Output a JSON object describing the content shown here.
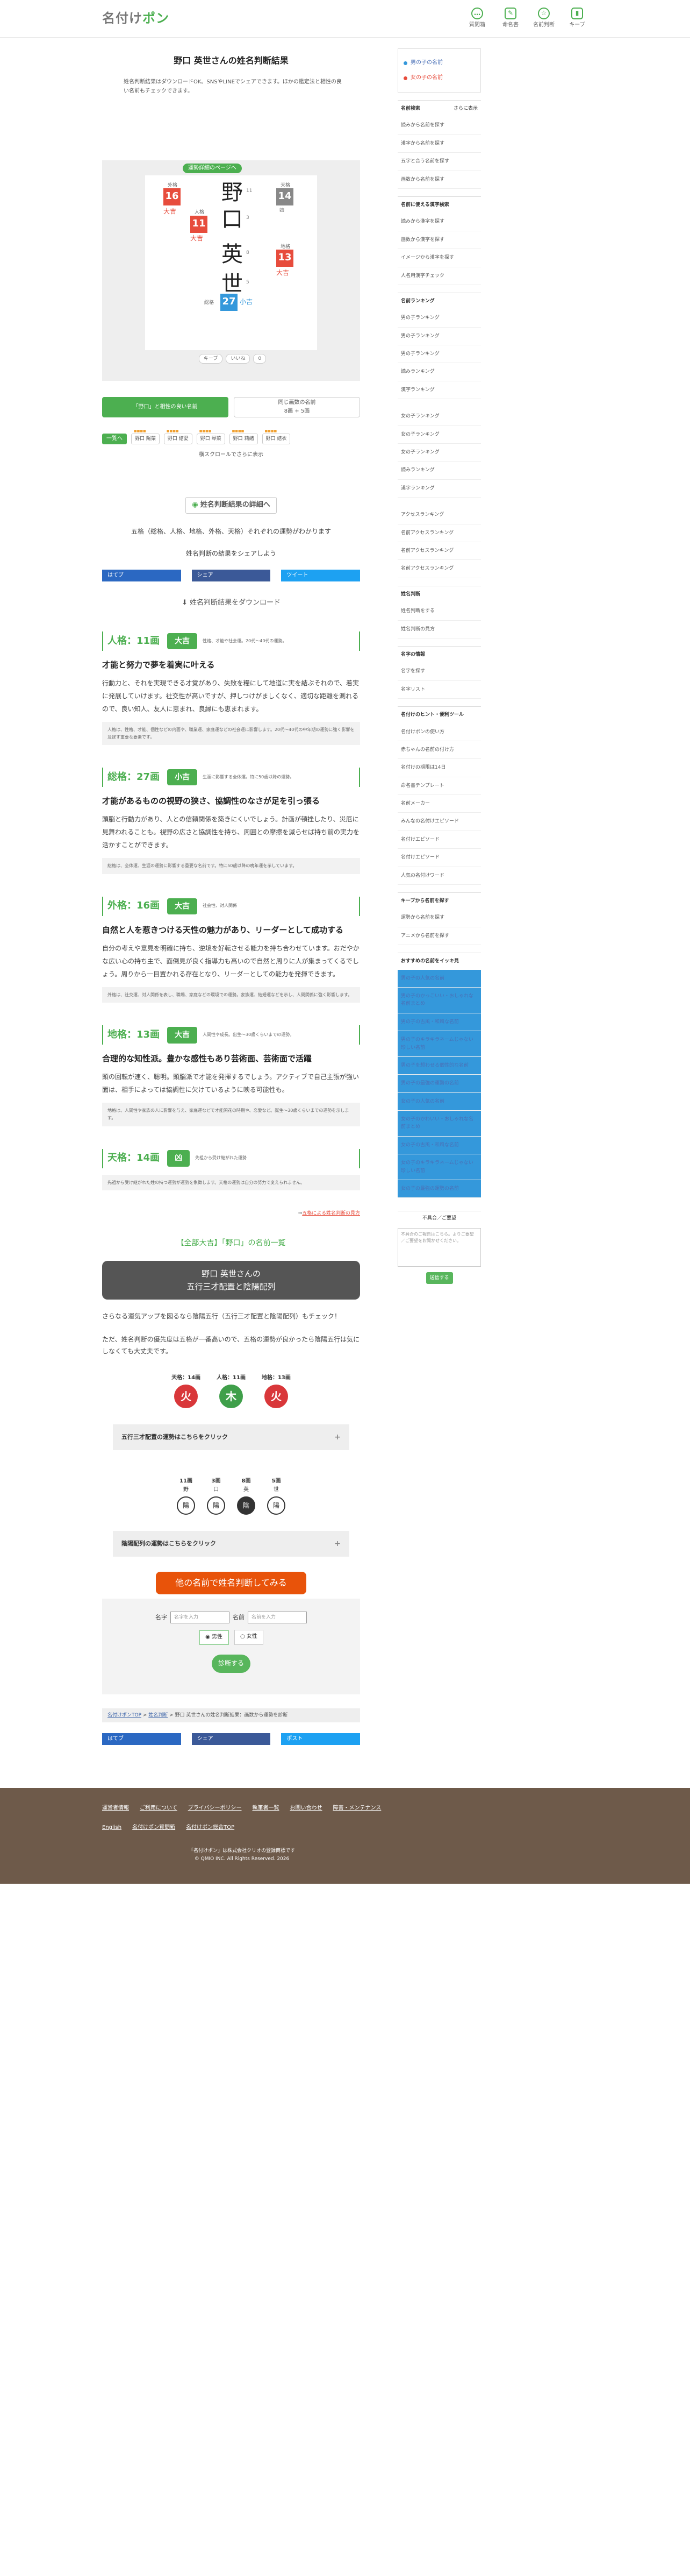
{
  "header": {
    "logo_main": "名付け",
    "logo_accent": "ポン",
    "nav": [
      {
        "label": "質問箱",
        "icon": "chat-icon"
      },
      {
        "label": "命名書",
        "icon": "edit-icon"
      },
      {
        "label": "名前判断",
        "icon": "star-icon"
      },
      {
        "label": "キープ",
        "icon": "bookmark-icon"
      }
    ]
  },
  "page": {
    "title": "野口 英世さんの姓名判断結果",
    "intro": "姓名判断結果はダウンロードOK。SNSやLINEでシェアできます。ほかの鑑定法と相性の良い名前もチェックできます。"
  },
  "board": {
    "tag": "運勢詳細のページへ",
    "kanji": [
      "野",
      "口",
      "英",
      "世"
    ],
    "strokes": [
      "11",
      "3",
      "8",
      "5"
    ],
    "boxes": {
      "jinkaku": "11",
      "ikaku_top": "16",
      "tenkaku": "14",
      "chikaku": "13",
      "soukaku": "27"
    },
    "labels": {
      "tenkaku": "天格",
      "jinkaku": "人格",
      "chikaku": "地格",
      "gaikaku": "外格",
      "soukaku": "総格",
      "daikichi": "大吉",
      "kokichi": "小吉",
      "kyo": "凶"
    },
    "btn_keep": "キープ",
    "btn_like": "いいね",
    "count": "0"
  },
  "tabs": [
    {
      "line1": "「野口」と相性の良い名前",
      "line2": ""
    },
    {
      "line1": "同じ画数の名前",
      "line2": "8画 + 5画"
    }
  ],
  "chips": {
    "all": "一覧へ",
    "items": [
      "野口 陽菜",
      "野口 結愛",
      "野口 琴菜",
      "野口 莉緒",
      "野口 結衣"
    ]
  },
  "scroll_note": "横スクロールでさらに表示",
  "detail_btn": "姓名判断結果の詳細へ",
  "gokaku_note": "五格（総格、人格、地格、外格、天格）それぞれの運勢がわかります",
  "share_note": "姓名判断の結果をシェアしよう",
  "share": {
    "hatena": "はてブ",
    "fb": "シェア",
    "tw": "ツイート"
  },
  "download": "姓名判断結果をダウンロード",
  "fortunes": [
    {
      "title": "人格：11画",
      "badge": "大吉",
      "desc": "性格、才能や社会運。20代〜40代の運勢。",
      "cat": "才能と努力で夢を着実に叶える",
      "body": "行動力と、それを実現できる才覚があり、失敗を糧にして地道に実を結ぶそれので、着実に発展していけます。社交性が高いですが、押しつけがましくなく、適切な距離を測れるので、良い知人、友人に恵まれ、良縁にも恵まれます。",
      "note": "人格は、性格、才能、個性などの内面や、職業運、家庭運などの社会運に影響します。20代〜40代の中年期の運勢に強く影響を及ぼす重要な要素です。"
    },
    {
      "title": "総格：27画",
      "badge": "小吉",
      "desc": "生涯に影響する全体運。特に50歳以降の運勢。",
      "cat": "才能があるものの視野の狭さ、協調性のなさが足を引っ張る",
      "body": "頭脳と行動力があり、人との信頼関係を築きにくいでしょう。計画が頓挫したり、災厄に見舞われることも。視野の広さと協調性を持ち、周囲との摩擦を減らせば持ち前の実力を活かすことができます。",
      "note": "総格は、全体運、生涯の運勢に影響する重要な名前です。特に50歳以降の晩年運を示しています。"
    },
    {
      "title": "外格：16画",
      "badge": "大吉",
      "desc": "社会性、対人関係",
      "cat": "自然と人を惹きつける天性の魅力があり、リーダーとして成功する",
      "body": "自分の考えや意見を明確に持ち、逆境を好転させる能力を持ち合わせています。おだやかな広い心の持ち主で、面倒見が良く指導力も高いので自然と周りに人が集まってくるでしょう。周りから一目置かれる存在となり、リーダーとしての能力を発揮できます。",
      "note": "外格は、社交運、対人関係を表し、職場、家庭などの環境での運勢。家族運、結婚運などを示し、人間関係に強く影響します。"
    },
    {
      "title": "地格：13画",
      "badge": "大吉",
      "desc": "人間性や成長。出生〜30歳くらいまでの運勢。",
      "cat": "合理的な知性派。豊かな感性もあり芸術面、芸術面で活躍",
      "body": "頭の回転が速く、聡明。頭脳派で才能を発揮するでしょう。アクティブで自己主張が強い面は、相手によっては協調性に欠けているように映る可能性も。",
      "note": "地格は、人間性や家族の人に影響を与え、家庭運などで才能開花の時期や、恋愛など。誕生〜30歳くらいまでの運勢を示します。"
    },
    {
      "title": "天格：14画",
      "badge": "凶",
      "desc": "先祖から受け継がれた運勢",
      "cat": "",
      "body": "",
      "note": "先祖から受け継がれた姓の持つ運勢が運勢を象徴します。天格の運勢は自分の努力で変えられません。"
    }
  ],
  "fortune_more_link": "五格による姓名判断の見方",
  "all_head": "【全部大吉】「野口」の名前一覧",
  "sansai": {
    "card_line1": "野口 英世さんの",
    "card_line2": "五行三才配置と陰陽配列",
    "para1": "さらなる運気アップを図るなら陰陽五行（五行三才配置と陰陽配列）もチェック！",
    "para2": "ただ、姓名判断の優先度は五格が一番高いので、五格の運勢が良かったら陰陽五行は気にしなくても大丈夫です。",
    "items": [
      {
        "label": "天格：14画",
        "el": "火",
        "color": "#d9373a"
      },
      {
        "label": "人格：11画",
        "el": "木",
        "color": "#3f9f4a"
      },
      {
        "label": "地格：13画",
        "el": "火",
        "color": "#d9373a"
      }
    ],
    "acc1": "五行三才配置の運勢はこちらをクリック",
    "inyo": [
      {
        "count": "11画",
        "kanji": "野",
        "yy": "陽",
        "dark": false
      },
      {
        "count": "3画",
        "kanji": "口",
        "yy": "陽",
        "dark": false
      },
      {
        "count": "8画",
        "kanji": "英",
        "yy": "陰",
        "dark": true
      },
      {
        "count": "5画",
        "kanji": "世",
        "yy": "陽",
        "dark": false
      }
    ],
    "acc2": "陰陽配列の運勢はこちらをクリック"
  },
  "form": {
    "banner": "他の名前で姓名判断してみる",
    "sei_label": "名字",
    "sei_ph": "名字を入力",
    "mei_label": "名前",
    "mei_ph": "名前を入力",
    "male": "男性",
    "female": "女性",
    "submit": "診断する"
  },
  "crumb": {
    "c1": "名付けポンTOP",
    "c2": "姓名判断",
    "c3": "野口 英世さんの姓名判断結果：画数から運勢を診断"
  },
  "share2": {
    "hatena": "はてブ",
    "fb": "シェア",
    "post": "ポスト"
  },
  "sidebar": {
    "sex": [
      {
        "label": "男の子の名前",
        "color": "#3498db"
      },
      {
        "label": "女の子の名前",
        "color": "#e74c3c"
      }
    ],
    "sections": [
      {
        "head": "名前検索",
        "tail": "さらに表示",
        "items": [
          "読みから名前を探す",
          "漢字から名前を探す",
          "五字と合う名前を探す",
          "画数から名前を探す"
        ]
      },
      {
        "head": "名前に使える漢字検索",
        "items": [
          "読みから漢字を探す",
          "画数から漢字を探す",
          "イメージから漢字を探す",
          "人名用漢字チェック"
        ]
      },
      {
        "head": "名前ランキング",
        "items": [
          "男の子ランキング",
          "男の子ランキング",
          "男の子ランキング",
          "読みランキング",
          "漢字ランキング"
        ]
      },
      {
        "head": "",
        "items": [
          "女の子ランキング",
          "女の子ランキング",
          "女の子ランキング",
          "読みランキング",
          "漢字ランキング"
        ]
      },
      {
        "head": "",
        "items": [
          "アクセスランキング",
          "名前アクセスランキング",
          "名前アクセスランキング",
          "名前アクセスランキング"
        ]
      },
      {
        "head": "姓名判断",
        "items": [
          "姓名判断をする",
          "姓名判断の見方"
        ]
      },
      {
        "head": "名字の情報",
        "items": [
          "名字を探す",
          "名字リスト"
        ]
      },
      {
        "head": "名付けのヒント・便利ツール",
        "items": [
          "名付けポンの使い方",
          "赤ちゃんの名前の付け方",
          "名付けの期限は14日",
          "命名書テンプレート",
          "名前メーカー",
          "みんなの名付けエピソード",
          "名付けエピソード",
          "名付けエピソード",
          "人気の名付けワード"
        ]
      },
      {
        "head": "キープから名前を探す",
        "items": [
          "運勢から名前を探す",
          "アニメから名前を探す"
        ]
      },
      {
        "head": "おすすめの名前をイッキ見",
        "items": [
          "男の子の人気の名前",
          "男の子のかっこいい・おしゃれな名前まとめ",
          "男の子の古風・和風な名前",
          "男の子のキラキラネームじゃない珍しい名前",
          "男の子を想わせる個性的な名前",
          "男の子の最強の運勢の名前",
          "女の子の人気の名前",
          "女の子のかわいい・おしゃれな名前まとめ",
          "女の子の古風・和風な名前",
          "女の子のキラキラネームじゃない珍しい名前",
          "女の子の最強の運勢の名前"
        ]
      }
    ],
    "feedback": {
      "head": "不具合／ご要望",
      "placeholder": "不具合のご報告はこちら。よりご要望／ご要望をお聞かせください。",
      "send": "送信する"
    }
  },
  "footer": {
    "links": [
      "運営者情報",
      "ご利用について",
      "プライバシーポリシー",
      "執筆者一覧",
      "お問い合わせ",
      "障害・メンテナンス",
      "English",
      "名付けポン質問箱",
      "名付けポン総合TOP"
    ],
    "copy1": "「名付けポン」は株式会社クリオの登録商標です",
    "copy2": "© QMIO INC. All Rights Reserved. 2026"
  }
}
